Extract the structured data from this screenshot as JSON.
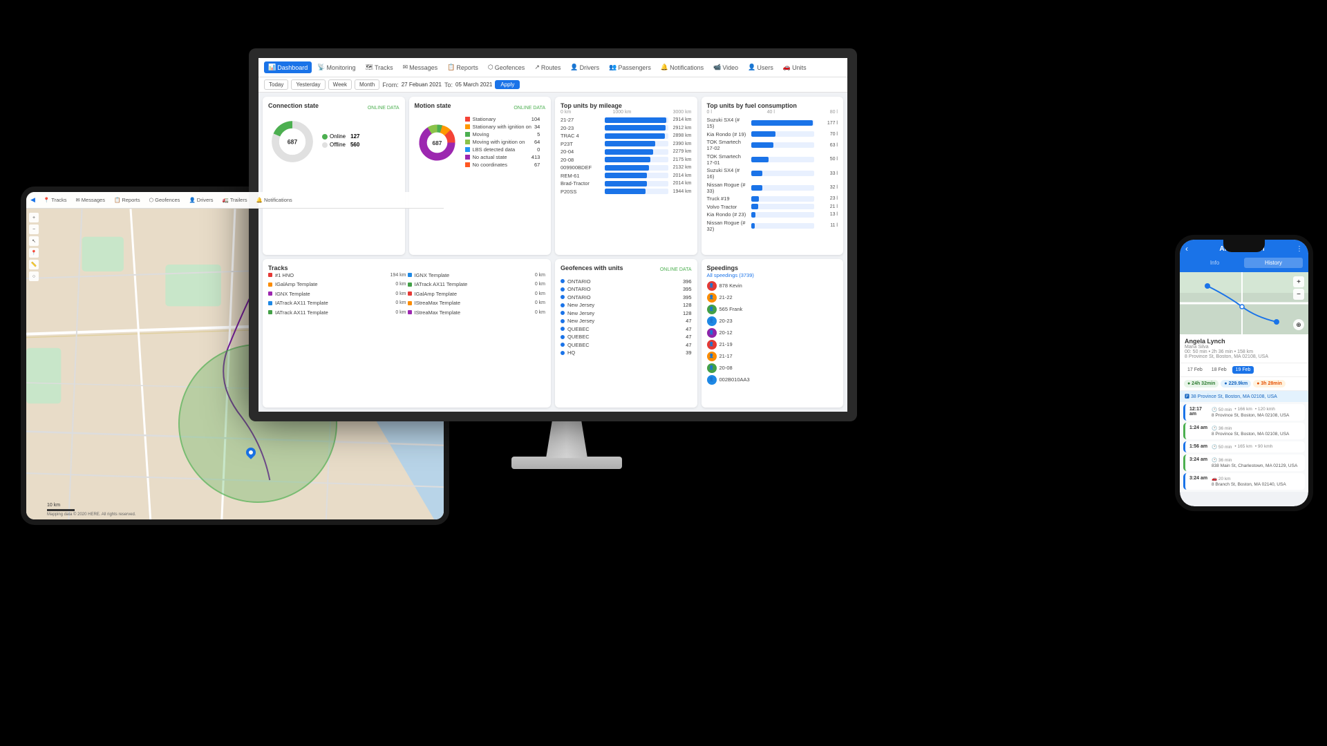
{
  "nav": {
    "items": [
      {
        "label": "Dashboard",
        "icon": "📊",
        "active": true
      },
      {
        "label": "Monitoring",
        "icon": "📡"
      },
      {
        "label": "Tracks",
        "icon": "🗺"
      },
      {
        "label": "Messages",
        "icon": "✉"
      },
      {
        "label": "Reports",
        "icon": "📋"
      },
      {
        "label": "Geofences",
        "icon": "⬡"
      },
      {
        "label": "Routes",
        "icon": "↗"
      },
      {
        "label": "Drivers",
        "icon": "👤"
      },
      {
        "label": "Passengers",
        "icon": "👥"
      },
      {
        "label": "Notifications",
        "icon": "🔔"
      },
      {
        "label": "Video",
        "icon": "📹"
      },
      {
        "label": "Users",
        "icon": "👤"
      },
      {
        "label": "Units",
        "icon": "🚗"
      }
    ]
  },
  "datebar": {
    "buttons": [
      "Today",
      "Yesterday",
      "Week",
      "Month"
    ],
    "from_label": "From:",
    "from_val": "27 Febuan 2021",
    "to_label": "To:",
    "to_val": "05 March 2021",
    "apply": "Apply"
  },
  "connection": {
    "title": "Connection state",
    "badge": "ONLINE DATA",
    "total": "687",
    "online_label": "Online",
    "online_val": "127",
    "offline_label": "Offline",
    "offline_val": "560"
  },
  "motion": {
    "title": "Motion state",
    "badge": "ONLINE DATA",
    "total": "687",
    "items": [
      {
        "label": "Stationary",
        "val": "104",
        "color": "#f44336"
      },
      {
        "label": "Stationary with ignition on",
        "val": "34",
        "color": "#ff9800"
      },
      {
        "label": "Moving",
        "val": "5",
        "color": "#4caf50"
      },
      {
        "label": "Moving with ignition on",
        "val": "64",
        "color": "#8bc34a"
      },
      {
        "label": "LBS detected data",
        "val": "0",
        "color": "#2196f3"
      },
      {
        "label": "No actual state",
        "val": "413",
        "color": "#9c27b0"
      },
      {
        "label": "No coordinates",
        "val": "67",
        "color": "#ff5722"
      }
    ]
  },
  "mileage": {
    "title": "Top units by mileage",
    "scale": [
      "0 km",
      "1000 km",
      "3000 km"
    ],
    "items": [
      {
        "label": "21-27",
        "val": "2914 km",
        "pct": 97
      },
      {
        "label": "20-23",
        "val": "2912 km",
        "pct": 96
      },
      {
        "label": "TRAC 4",
        "val": "2898 km",
        "pct": 95
      },
      {
        "label": "P23T",
        "val": "2390 km",
        "pct": 80
      },
      {
        "label": "20-04",
        "val": "2279 km",
        "pct": 76
      },
      {
        "label": "20-08",
        "val": "2175 km",
        "pct": 72
      },
      {
        "label": "009900BDEF",
        "val": "2132 km",
        "pct": 70
      },
      {
        "label": "REM-61",
        "val": "2014 km",
        "pct": 67
      },
      {
        "label": "Brad-Tractor",
        "val": "2014 km",
        "pct": 67
      },
      {
        "label": "P20SS",
        "val": "1944 km",
        "pct": 64
      }
    ]
  },
  "fuel": {
    "title": "Top units by fuel consumption",
    "scale": [
      "0 l",
      "40 l",
      "80 l"
    ],
    "items": [
      {
        "label": "Suzuki SX4 (# 15)",
        "val": "177 l",
        "pct": 98
      },
      {
        "label": "Kia Rondo (# 19)",
        "val": "70 l",
        "pct": 39
      },
      {
        "label": "TOK Smartech 17-02",
        "val": "63 l",
        "pct": 35
      },
      {
        "label": "TOK Smartech 17-01",
        "val": "50 l",
        "pct": 28
      },
      {
        "label": "Suzuki SX4 (# 16)",
        "val": "33 l",
        "pct": 18
      },
      {
        "label": "Nissan Rogue (# 33)",
        "val": "32 l",
        "pct": 18
      },
      {
        "label": "Truck #19",
        "val": "23 l",
        "pct": 13
      },
      {
        "label": "Volvo Tractor",
        "val": "21 l",
        "pct": 12
      },
      {
        "label": "Kia Rondo (# 23)",
        "val": "13 l",
        "pct": 7
      },
      {
        "label": "Nissan Rogue (# 32)",
        "val": "11 l",
        "pct": 6
      }
    ]
  },
  "geofences": {
    "title": "Geofences with units",
    "badge": "ONLINE DATA",
    "items": [
      {
        "label": "ONTARIO",
        "val": "396"
      },
      {
        "label": "ONTARIO",
        "val": "395"
      },
      {
        "label": "ONTARIO",
        "val": "395"
      },
      {
        "label": "New Jersey",
        "val": "128"
      },
      {
        "label": "New Jersey",
        "val": "128"
      },
      {
        "label": "New Jersey",
        "val": "47"
      },
      {
        "label": "QUEBEC",
        "val": "47"
      },
      {
        "label": "QUEBEC",
        "val": "47"
      },
      {
        "label": "QUEBEC",
        "val": "47"
      },
      {
        "label": "HQ",
        "val": "39"
      }
    ]
  },
  "speedings": {
    "title": "Speedings",
    "all_label": "All speedings (3739)",
    "items": [
      {
        "name": "878 Kevin",
        "color": "#e53935"
      },
      {
        "name": "21-22",
        "color": "#fb8c00"
      },
      {
        "name": "565 Frank",
        "color": "#43a047"
      },
      {
        "name": "20-23",
        "color": "#1e88e5"
      },
      {
        "name": "20-12",
        "color": "#8e24aa"
      },
      {
        "name": "21-19",
        "color": "#e53935"
      },
      {
        "name": "21-17",
        "color": "#fb8c00"
      },
      {
        "name": "20-08",
        "color": "#43a047"
      },
      {
        "name": "002B010AA3",
        "color": "#1e88e5"
      }
    ]
  },
  "tracks": {
    "title": "Tracks",
    "headers": [
      "#1 HNO",
      "194 km",
      "#IGNX Template",
      "0 km",
      "#IGalAmp Template",
      "0 km"
    ],
    "items": [
      {
        "label": "#1 HNO",
        "val": "194 km",
        "color": "#e53935"
      },
      {
        "label": "IGNX Template",
        "val": "0 km",
        "color": "#1e88e5"
      },
      {
        "label": "IGalAmp Template",
        "val": "0 km",
        "color": "#fb8c00"
      },
      {
        "label": "IATrack AX11 Template",
        "val": "0 km",
        "color": "#43a047"
      },
      {
        "label": "IGNX Template",
        "val": "0 km",
        "color": "#9c27b0"
      },
      {
        "label": "IGalAmp Template",
        "val": "0 km",
        "color": "#e53935"
      },
      {
        "label": "IATrack AX11 Template",
        "val": "0 km",
        "color": "#1e88e5"
      },
      {
        "label": "IStreaMax Template",
        "val": "0 km",
        "color": "#fb8c00"
      },
      {
        "label": "IATrack AX11 Template",
        "val": "0 km",
        "color": "#43a047"
      },
      {
        "label": "IStreaMax Template",
        "val": "0 km",
        "color": "#9c27b0"
      }
    ]
  },
  "phone": {
    "driver_name": "Angela Lynch",
    "info_tab": "Info",
    "history_tab": "History",
    "driver_sub": "Maria Silva",
    "driver_detail": "00: 50 min • 2h 36 min • 158 km",
    "driver_location": "8 Province St, Boston, MA 02108, USA",
    "dates": [
      "17 Feb",
      "18 Feb",
      "19 Feb"
    ],
    "stats": [
      {
        "label": "24h 32min",
        "type": "green"
      },
      {
        "label": "229.9km",
        "type": "blue"
      },
      {
        "label": "3h 28min",
        "type": "orange"
      }
    ],
    "trips": [
      {
        "time": "12:17 am",
        "stats": "00 50 min • 166 km • 120 kmh",
        "addr": "8 Province St, Boston, MA 02108, USA"
      },
      {
        "time": "1:24 am",
        "stats": "00 36 min",
        "addr": "8 Province St, Boston, MA 02108, USA"
      },
      {
        "time": "1:56 am",
        "stats": "00 50 min • 165 km • 90 kmh",
        "addr": ""
      },
      {
        "time": "3:24 am",
        "stats": "00 36 min",
        "addr": "838 Main St, Charlestown, MA 02129, USA"
      },
      {
        "time": "3:24 am",
        "stats": "00 20 km",
        "addr": "8 Branch St, Boston, MA 02140, USA"
      }
    ]
  },
  "tablet": {
    "nav_items": [
      "Tracks",
      "Messages",
      "Reports",
      "Geofences",
      "Drivers",
      "Trailers",
      "Notifications"
    ],
    "scale_label": "10 km",
    "copyright": "Mapping data © 2020 HERE. All rights reserved."
  }
}
